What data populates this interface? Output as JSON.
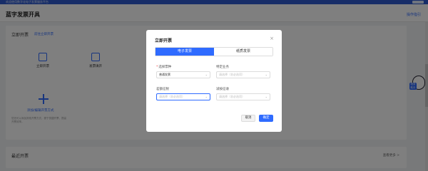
{
  "topbar": {
    "notice": "欢迎使用数字化电子发票服务平台"
  },
  "header": {
    "title": "蓝字发票开具",
    "link": "操作指引"
  },
  "quick": {
    "title": "立即开票",
    "link": "前往立即开票",
    "items": [
      {
        "label": "立即开票"
      },
      {
        "label": "发票填开"
      }
    ],
    "add_label": "添加/编辑开票方式",
    "tip": "您还可以添加其他开票方式，便于快捷开票，提高开票效率。"
  },
  "recent": {
    "title": "最近开票",
    "more": "查看更多 >"
  },
  "mascot": {
    "badge": "税务助手"
  },
  "modal": {
    "title": "立即开票",
    "close": "×",
    "tabs": [
      {
        "label": "电子发票"
      },
      {
        "label": "纸质发票"
      }
    ],
    "fields": {
      "invoice_type": {
        "label": "选择票种",
        "value": "普通发票",
        "required": true
      },
      "special_type": {
        "label": "特定业务",
        "placeholder": "请选择（非必选项）"
      },
      "diff_tax": {
        "label": "差额征税",
        "placeholder": "请选择（非必选项）"
      },
      "reduce_tax": {
        "label": "减按征收",
        "placeholder": "请选择（非必选项）"
      }
    },
    "cancel": "取消",
    "confirm": "确定"
  },
  "colors": {
    "primary": "#2f6bff",
    "overlay": "rgba(0,0,0,0.5)"
  }
}
